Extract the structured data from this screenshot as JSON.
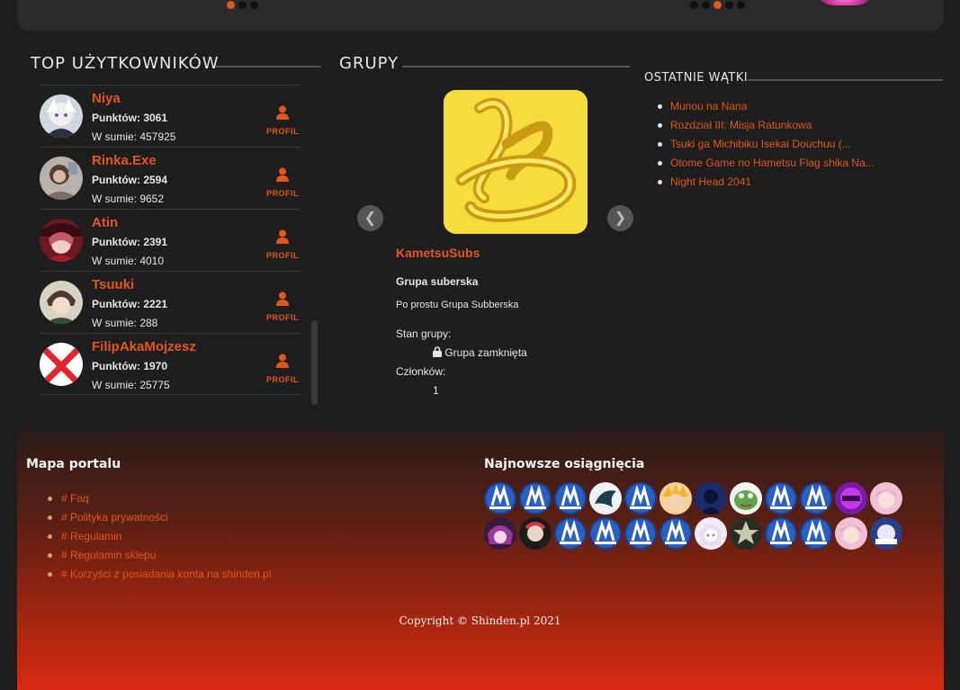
{
  "top_users": {
    "title": "TOP UŻYTKOWNIKÓW",
    "profile_label": "PROFIL",
    "users": [
      {
        "name": "Niya",
        "points": "Punktów: 3061",
        "total": "W sumie: 457925"
      },
      {
        "name": "Rinka.Exe",
        "points": "Punktów: 2594",
        "total": "W sumie: 9652"
      },
      {
        "name": "Atin",
        "points": "Punktów: 2391",
        "total": "W sumie: 4010"
      },
      {
        "name": "Tsuuki",
        "points": "Punktów: 2221",
        "total": "W sumie: 288"
      },
      {
        "name": "FilipAkaMojzesz",
        "points": "Punktów: 1970",
        "total": "W sumie: 25775"
      }
    ]
  },
  "groups": {
    "title": "GRUPY",
    "prev_label": "❮",
    "next_label": "❯",
    "name": "KametsuSubs",
    "type": "Grupa suberska",
    "description": "Po prostu Grupa Subberska",
    "state_label": "Stan grupy:",
    "state_value": "Grupa zamknięta",
    "members_label": "Członków:",
    "members_value": "1"
  },
  "threads": {
    "title": "OSTATNIE WĄTKI",
    "items": [
      "Munou na Nana",
      "Rozdział III: Misja Ratunkowa",
      "Tsuki ga Michibiku Isekai Douchuu (...",
      "Otome Game no Hametsu Flag shika Na...",
      "Night Head 2041"
    ]
  },
  "footer": {
    "map_title": "Mapa portalu",
    "links": [
      "# Faq",
      "# Polityka prywatności",
      "# Regulamin",
      "# Regulamin sklepu",
      "# Korzyści z posiadania konta na shinden.pl"
    ],
    "achievements_title": "Najnowsze osiągnięcia",
    "achievement_count": 24,
    "copyright": "Copyright © Shinden.pl 2021"
  },
  "colors": {
    "accent": "#e2571c",
    "background": "#1e1e1e",
    "footer_bottom": "#d92a12"
  }
}
